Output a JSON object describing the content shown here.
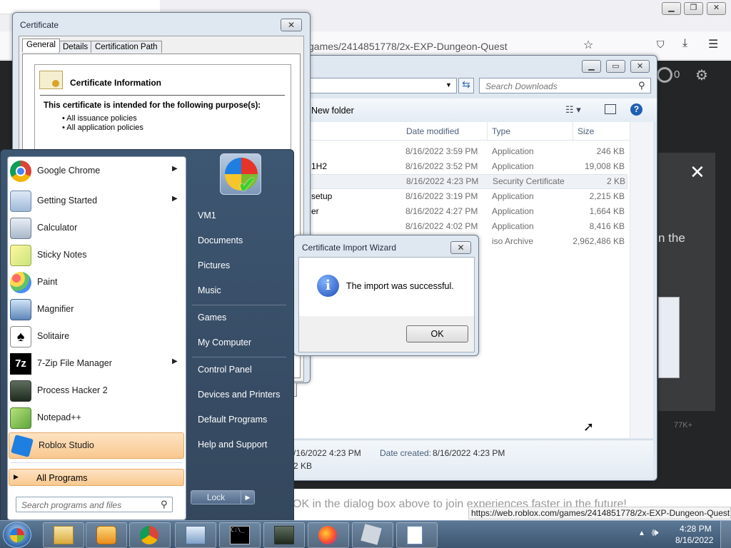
{
  "browser": {
    "url": "games/2414851778/2x-EXP-Dungeon-Quest",
    "counter": "0",
    "banner_text": "OK in the dialog box above to join experiences faster in the future!",
    "side_text": "n the",
    "count_label": "77K+",
    "status_url": "https://web.roblox.com/games/2414851778/2x-EXP-Dungeon-Quest"
  },
  "explorer": {
    "search_placeholder": "Search Downloads",
    "new_folder": "New folder",
    "columns": [
      "Date modified",
      "Type",
      "Size"
    ],
    "rows": [
      {
        "name": "",
        "date": "8/16/2022 3:59 PM",
        "type": "Application",
        "size": "246 KB"
      },
      {
        "name": "1H2",
        "date": "8/16/2022 3:52 PM",
        "type": "Application",
        "size": "19,008 KB"
      },
      {
        "name": "",
        "date": "8/16/2022 4:23 PM",
        "type": "Security Certificate",
        "size": "2 KB"
      },
      {
        "name": "setup",
        "date": "8/16/2022 3:19 PM",
        "type": "Application",
        "size": "2,215 KB"
      },
      {
        "name": "er",
        "date": "8/16/2022 4:27 PM",
        "type": "Application",
        "size": "1,664 KB"
      },
      {
        "name": "",
        "date": "8/16/2022 4:02 PM",
        "type": "Application",
        "size": "8,416 KB"
      },
      {
        "name": "",
        "date": "",
        "type": "iso Archive",
        "size": "2,962,486 KB"
      }
    ],
    "details": {
      "modified": "/16/2022 4:23 PM",
      "created_label": "Date created:",
      "created": "8/16/2022 4:23 PM",
      "size": "2 KB"
    }
  },
  "certificate": {
    "title": "Certificate",
    "tabs": [
      "General",
      "Details",
      "Certification Path"
    ],
    "info_title": "Certificate Information",
    "purpose_heading": "This certificate is intended for the following purpose(s):",
    "purposes": [
      "• All issuance policies",
      "• All application policies"
    ]
  },
  "start_menu": {
    "programs": [
      {
        "label": "Google Chrome",
        "arrow": true,
        "icon": "chrome-icon"
      },
      {
        "label": "Getting Started",
        "arrow": true,
        "icon": "getting-started-icon"
      },
      {
        "label": "Calculator",
        "arrow": false,
        "icon": "calculator-icon"
      },
      {
        "label": "Sticky Notes",
        "arrow": false,
        "icon": "sticky-notes-icon"
      },
      {
        "label": "Paint",
        "arrow": false,
        "icon": "paint-icon"
      },
      {
        "label": "Magnifier",
        "arrow": false,
        "icon": "magnifier-icon"
      },
      {
        "label": "Solitaire",
        "arrow": false,
        "icon": "solitaire-icon"
      },
      {
        "label": "7-Zip File Manager",
        "arrow": true,
        "icon": "7zip-icon"
      },
      {
        "label": "Process Hacker 2",
        "arrow": false,
        "icon": "process-hacker-icon"
      },
      {
        "label": "Notepad++",
        "arrow": false,
        "icon": "notepadpp-icon"
      },
      {
        "label": "Roblox Studio",
        "arrow": false,
        "icon": "roblox-studio-icon"
      }
    ],
    "all_programs": "All Programs",
    "search_placeholder": "Search programs and files",
    "right_items": [
      "VM1",
      "Documents",
      "Pictures",
      "Music",
      "Games",
      "My Computer",
      "Control Panel",
      "Devices and Printers",
      "Default Programs",
      "Help and Support"
    ],
    "lock_label": "Lock"
  },
  "dialog": {
    "title": "Certificate Import Wizard",
    "message": "The import was successful.",
    "ok": "OK"
  },
  "taskbar": {
    "time": "4:28 PM",
    "date": "8/16/2022"
  }
}
